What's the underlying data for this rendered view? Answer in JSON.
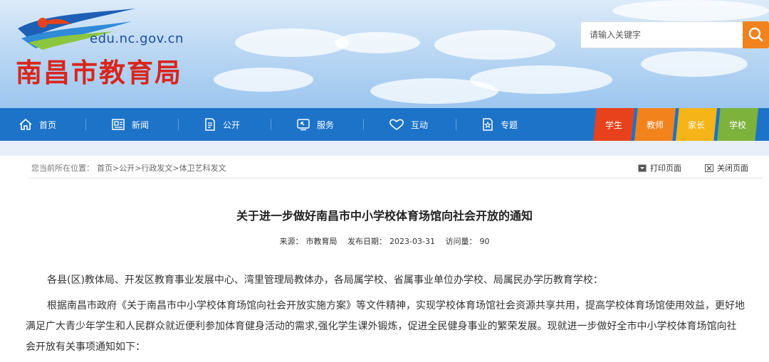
{
  "header": {
    "domain": "edu.nc.gov.cn",
    "title": "南昌市教育局",
    "search_placeholder": "请输入关键字"
  },
  "nav": {
    "items": [
      {
        "label": "首页",
        "icon": "home-icon"
      },
      {
        "label": "新闻",
        "icon": "news-icon"
      },
      {
        "label": "公开",
        "icon": "document-icon"
      },
      {
        "label": "服务",
        "icon": "service-icon"
      },
      {
        "label": "互动",
        "icon": "heart-icon"
      },
      {
        "label": "专题",
        "icon": "special-topic-icon"
      }
    ],
    "roles": [
      {
        "label": "学生",
        "color": "#e8421d"
      },
      {
        "label": "教师",
        "color": "#f2831c"
      },
      {
        "label": "家长",
        "color": "#f5b418"
      },
      {
        "label": "学校",
        "color": "#7db23c"
      }
    ]
  },
  "breadcrumb": {
    "label": "您当前所在位置：",
    "path": "首页>公开>行政发文>体卫艺科发文"
  },
  "tools": {
    "print": "打印页面",
    "close": "关闭页面"
  },
  "article": {
    "title": "关于进一步做好南昌市中小学校体育场馆向社会开放的通知",
    "source_label": "来源：",
    "source": "市教育局",
    "date_label": "发布日期：",
    "date": "2023-03-31",
    "views_label": "访问量：",
    "views": "90",
    "paragraphs": [
      "各县(区)教体局、开发区教育事业发展中心、湾里管理局教体办，各局属学校、省属事业单位办学校、局属民办学历教育学校：",
      "根据南昌市政府《关于南昌市中小学校体育场馆向社会开放实施方案》等文件精神，实现学校体育场馆社会资源共享共用，提高学校体育场馆使用效益，更好地满足广大青少年学生和人民群众就近便利参加体育健身活动的需求,强化学生课外锻炼，促进全民健身事业的繁荣发展。现就进一步做好全市中小学校体育场馆向社会开放有关事项通知如下："
    ]
  }
}
